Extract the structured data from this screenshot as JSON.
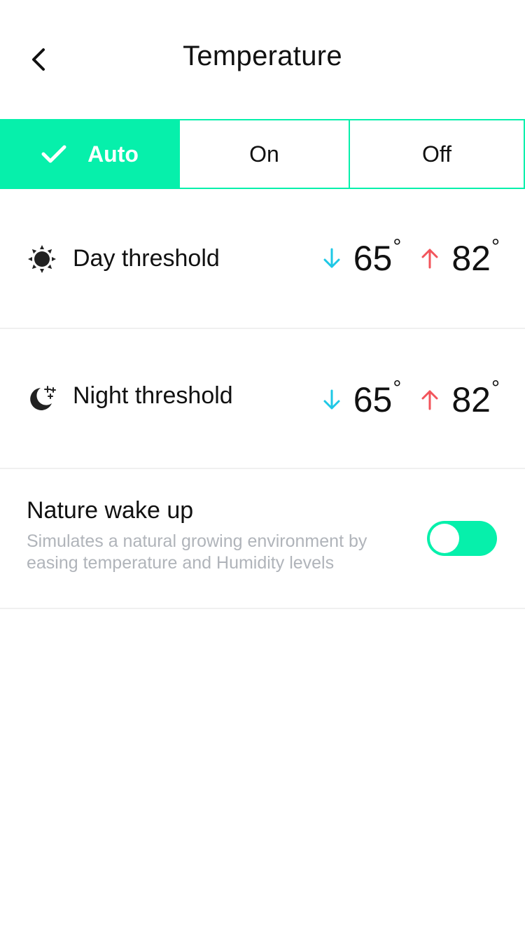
{
  "header": {
    "title": "Temperature",
    "back_icon": "chevron-left-icon"
  },
  "mode": {
    "options": [
      "Auto",
      "On",
      "Off"
    ],
    "selected": "Auto",
    "accent_color": "#06f0ab"
  },
  "thresholds": [
    {
      "icon": "sun-icon",
      "label": "Day threshold",
      "low": "65",
      "high": "82",
      "unit": "°"
    },
    {
      "icon": "moon-stars-icon",
      "label": "Night threshold",
      "low": "65",
      "high": "82",
      "unit": "°"
    }
  ],
  "colors": {
    "low_arrow": "#1ec8e6",
    "high_arrow": "#f2545b"
  },
  "nature_wake_up": {
    "title": "Nature wake up",
    "description": "Simulates a natural growing environment by easing temperature and Humidity levels",
    "enabled": true
  }
}
